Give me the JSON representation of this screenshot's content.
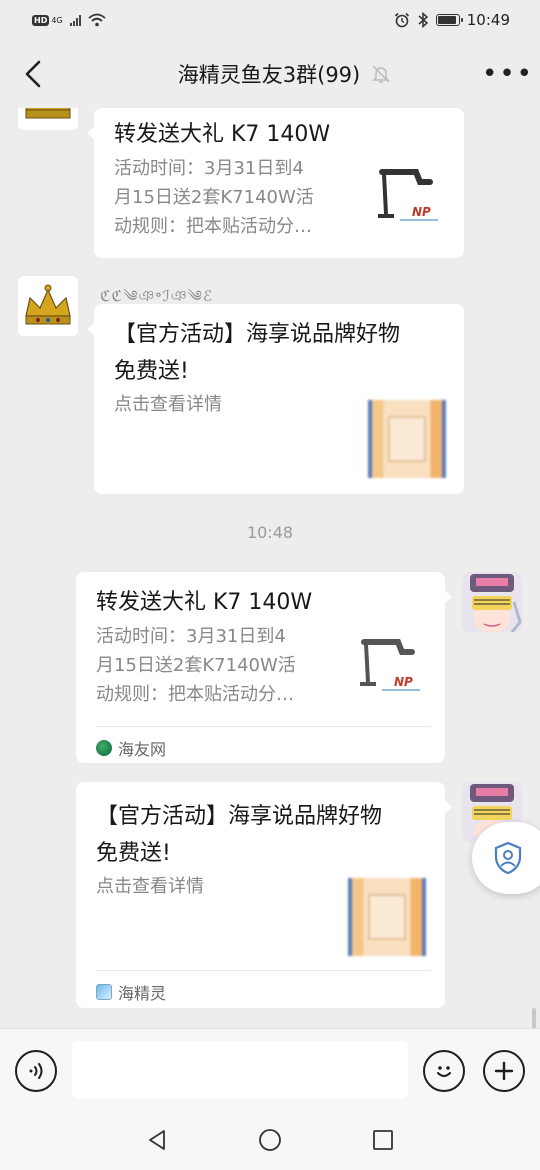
{
  "status_bar": {
    "hd": "HD",
    "network": "4G",
    "time": "10:49"
  },
  "header": {
    "title": "海精灵鱼友3群(99)"
  },
  "messages": [
    {
      "title": "转发送大礼 K7 140W",
      "desc_lines": [
        "活动时间：3月31日到4",
        "月15日送2套K7140W活",
        "动规则：把本贴活动分…"
      ],
      "thumb_brand": "NP"
    },
    {
      "nickname_art": "ℭℭ༄ঞ॰ℐঞ༄ℰ",
      "title_lines": [
        "【官方活动】海享说品牌好物",
        "免费送!"
      ],
      "desc": "点击查看详情"
    },
    {
      "timestamp": "10:48"
    },
    {
      "title": "转发送大礼 K7 140W",
      "desc_lines": [
        "活动时间：3月31日到4",
        "月15日送2套K7140W活",
        "动规则：把本贴活动分…"
      ],
      "thumb_brand": "NP",
      "source": "海友网"
    },
    {
      "title_lines": [
        "【官方活动】海享说品牌好物",
        "免费送!"
      ],
      "desc": "点击查看详情",
      "source": "海精灵"
    }
  ],
  "icons": {
    "back": "chevron-left-icon",
    "mute": "bell-off-icon",
    "more": "more-icon",
    "voice": "voice-icon",
    "emoji": "emoji-icon",
    "plus": "plus-icon"
  },
  "colors": {
    "background": "#ededed",
    "bubble": "#ffffff",
    "accent_source": "#1a8f4a"
  }
}
